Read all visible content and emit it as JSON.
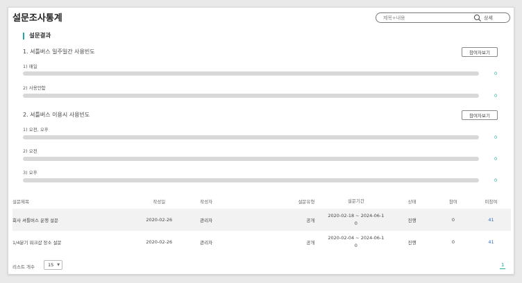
{
  "header": {
    "title": "설문조사통계",
    "search_placeholder": "제목+내용",
    "detail_label": "상세"
  },
  "results": {
    "section_title": "설문결과",
    "questions": [
      {
        "title": "1. 셔틀버스 일주일간 사용빈도",
        "button": "참여자보기",
        "options": [
          {
            "label": "1) 매일",
            "count": "0",
            "ratio": 0
          },
          {
            "label": "2) 사용안함",
            "count": "0",
            "ratio": 0
          }
        ]
      },
      {
        "title": "2. 셔틀버스 이용시 사용빈도",
        "button": "참여자보기",
        "options": [
          {
            "label": "1) 오전, 오후",
            "count": "0",
            "ratio": 0
          },
          {
            "label": "2) 오전",
            "count": "0",
            "ratio": 0
          },
          {
            "label": "3) 오후",
            "count": "0",
            "ratio": 0
          }
        ]
      }
    ]
  },
  "table": {
    "headers": [
      "설문제목",
      "작성일",
      "작성자",
      "설문유형",
      "설문기간",
      "상태",
      "참여",
      "미참여"
    ],
    "rows": [
      {
        "title": "회사 셔틀버스 운행 설문",
        "date": "2020-02-26",
        "author": "관리자",
        "type": "공개",
        "period_line1": "2020-02-18 ~ 2024-06-1",
        "period_line2": "0",
        "status": "진행",
        "participants": "0",
        "non_participants": "41"
      },
      {
        "title": "1/4분기 워크샵 장소 설문",
        "date": "2020-02-26",
        "author": "관리자",
        "type": "공개",
        "period_line1": "2020-02-04 ~ 2024-06-1",
        "period_line2": "0",
        "status": "진행",
        "participants": "0",
        "non_participants": "41"
      }
    ]
  },
  "footer": {
    "list_count_label": "리스트 개수",
    "page_size": "15",
    "current_page": "1"
  },
  "colors": {
    "accent": "#20a9a2",
    "link": "#2b6cc4",
    "bar_track": "#d8d8d8"
  }
}
